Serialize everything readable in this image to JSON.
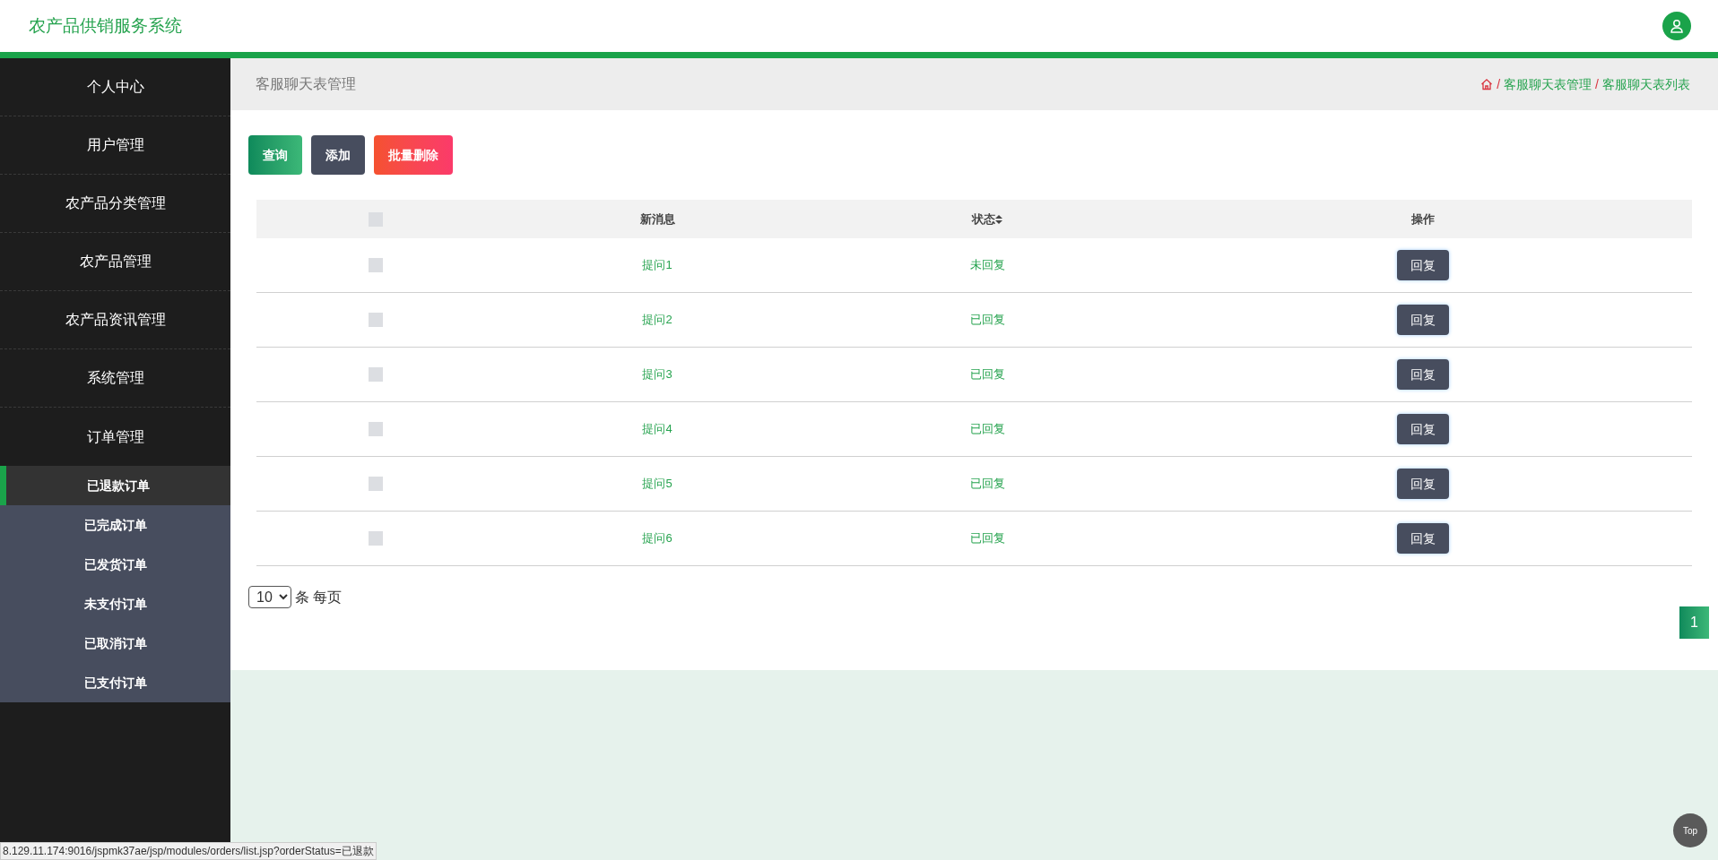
{
  "header": {
    "title": "农产品供销服务系统"
  },
  "sidebar": {
    "items": [
      {
        "label": "个人中心",
        "expanded": false
      },
      {
        "label": "用户管理",
        "expanded": false
      },
      {
        "label": "农产品分类管理",
        "expanded": false
      },
      {
        "label": "农产品管理",
        "expanded": false
      },
      {
        "label": "农产品资讯管理",
        "expanded": false
      },
      {
        "label": "系统管理",
        "expanded": false
      },
      {
        "label": "订单管理",
        "expanded": true,
        "children": [
          {
            "label": "已退款订单",
            "selected": true
          },
          {
            "label": "已完成订单",
            "selected": false
          },
          {
            "label": "已发货订单",
            "selected": false
          },
          {
            "label": "未支付订单",
            "selected": false
          },
          {
            "label": "已取消订单",
            "selected": false
          },
          {
            "label": "已支付订单",
            "selected": false
          }
        ]
      }
    ]
  },
  "page_title": "客服聊天表管理",
  "breadcrumb": [
    {
      "separator": "/",
      "label": "客服聊天表管理"
    },
    {
      "separator": "/",
      "label": "客服聊天表列表"
    }
  ],
  "toolbar": [
    {
      "label": "查询",
      "kind": "search"
    },
    {
      "label": "添加",
      "kind": "add"
    },
    {
      "label": "批量删除",
      "kind": "delete"
    }
  ],
  "table": {
    "select_all_checked": false,
    "columns": [
      "新消息",
      "状态",
      "操作"
    ],
    "rows": [
      {
        "message": "提问1",
        "status": "未回复",
        "action": "回复",
        "checked": false
      },
      {
        "message": "提问2",
        "status": "已回复",
        "action": "回复",
        "checked": false
      },
      {
        "message": "提问3",
        "status": "已回复",
        "action": "回复",
        "checked": false
      },
      {
        "message": "提问4",
        "status": "已回复",
        "action": "回复",
        "checked": false
      },
      {
        "message": "提问5",
        "status": "已回复",
        "action": "回复",
        "checked": false
      },
      {
        "message": "提问6",
        "status": "已回复",
        "action": "回复",
        "checked": false
      }
    ]
  },
  "pagination": {
    "page_size": "10",
    "page_size_label": "条 每页",
    "pages": [
      {
        "label": "1",
        "selected": true
      }
    ]
  },
  "top_button": "Top",
  "status_bar": "8.129.11.174:9016/jspmk37ae/jsp/modules/orders/list.jsp?orderStatus=已退款"
}
